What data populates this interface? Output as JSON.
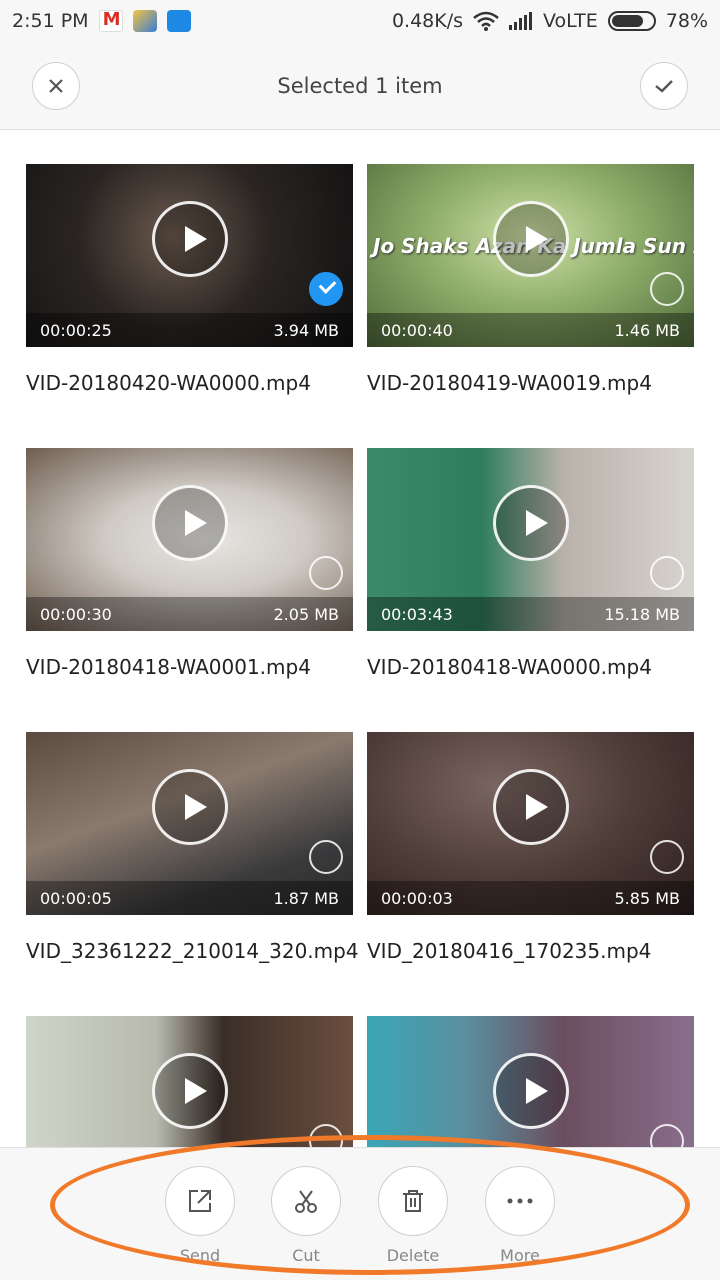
{
  "status_bar": {
    "time": "2:51 PM",
    "net_speed": "0.48K/s",
    "carrier": "VoLTE",
    "battery": "78%",
    "battery_level": 0.78
  },
  "header": {
    "title": "Selected 1 item"
  },
  "videos": [
    {
      "name": "VID-20180420-WA0000.mp4",
      "duration": "00:00:25",
      "size": "3.94 MB",
      "selected": true
    },
    {
      "name": "VID-20180419-WA0019.mp4",
      "duration": "00:00:40",
      "size": "1.46 MB",
      "selected": false,
      "overlay": "Jo Shaks Azan Ka Jumla Sun Kr;;"
    },
    {
      "name": "VID-20180418-WA0001.mp4",
      "duration": "00:00:30",
      "size": "2.05 MB",
      "selected": false
    },
    {
      "name": "VID-20180418-WA0000.mp4",
      "duration": "00:03:43",
      "size": "15.18 MB",
      "selected": false
    },
    {
      "name": "VID_32361222_210014_320.mp4",
      "duration": "00:00:05",
      "size": "1.87 MB",
      "selected": false
    },
    {
      "name": "VID_20180416_170235.mp4",
      "duration": "00:00:03",
      "size": "5.85 MB",
      "selected": false
    },
    {
      "name": "",
      "duration": "",
      "size": "",
      "selected": false
    },
    {
      "name": "",
      "duration": "",
      "size": "",
      "selected": false
    }
  ],
  "actions": {
    "send": "Send",
    "cut": "Cut",
    "delete": "Delete",
    "more": "More"
  },
  "colors": {
    "accent": "#2196f3",
    "highlight": "#f07a2a"
  }
}
